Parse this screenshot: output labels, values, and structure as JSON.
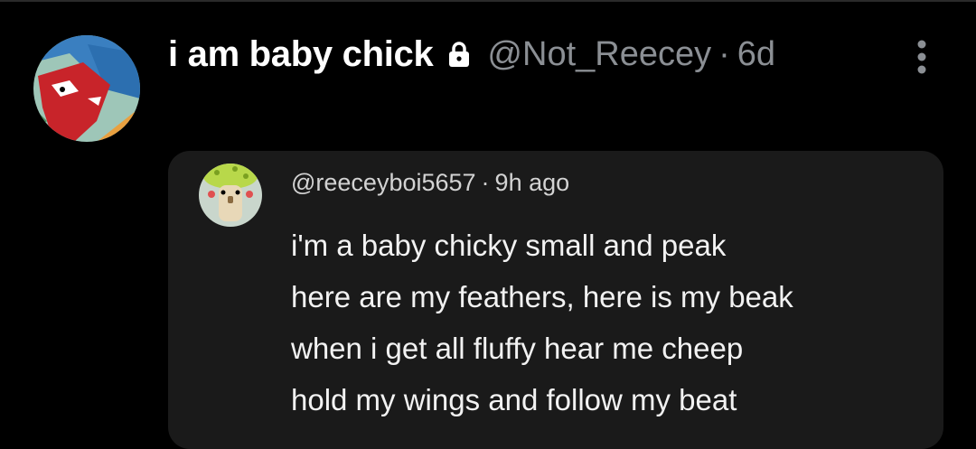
{
  "post": {
    "display_name": "i am baby chick",
    "handle": "@Not_Reecey",
    "separator": "·",
    "time": "6d",
    "icons": {
      "locked": "lock-icon",
      "more": "more-vertical-icon"
    }
  },
  "quote": {
    "handle": "@reeceyboi5657",
    "separator": "·",
    "time": "9h ago",
    "lines": [
      "i'm a baby chicky small and peak",
      "here are my feathers, here is my beak",
      "when i get all fluffy hear me cheep",
      "hold my wings and follow my beat"
    ]
  },
  "colors": {
    "background": "#000000",
    "card_background": "#1a1a1a",
    "muted_text": "#8b8f94",
    "primary_text": "#ffffff"
  }
}
